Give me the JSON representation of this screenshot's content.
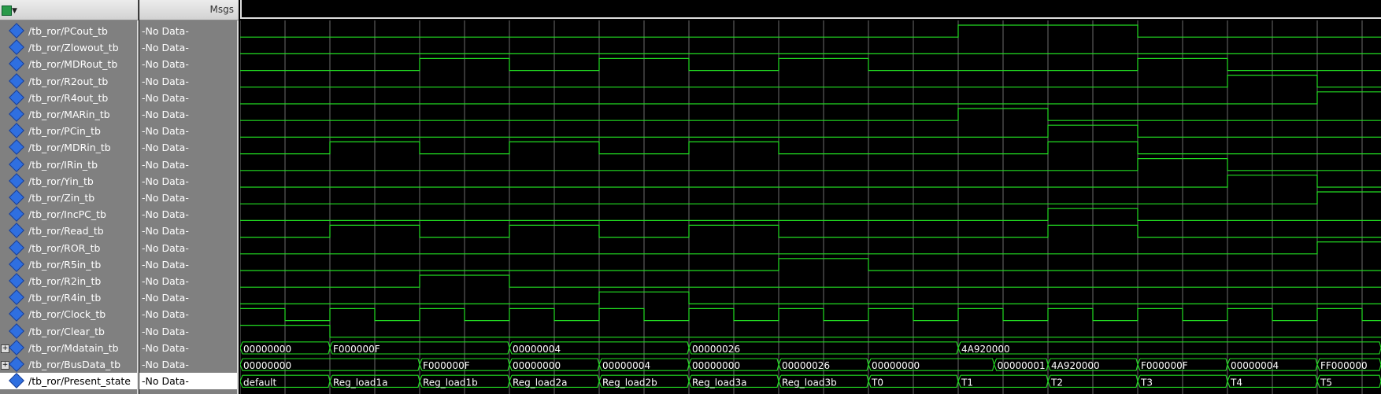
{
  "header": {
    "msgs_label": "Msgs",
    "arrow_icon": "wave-arrow-icon"
  },
  "signals": [
    {
      "name": "/tb_ror/PCout_tb",
      "msg": "-No Data-"
    },
    {
      "name": "/tb_ror/Zlowout_tb",
      "msg": "-No Data-"
    },
    {
      "name": "/tb_ror/MDRout_tb",
      "msg": "-No Data-"
    },
    {
      "name": "/tb_ror/R2out_tb",
      "msg": "-No Data-"
    },
    {
      "name": "/tb_ror/R4out_tb",
      "msg": "-No Data-"
    },
    {
      "name": "/tb_ror/MARin_tb",
      "msg": "-No Data-"
    },
    {
      "name": "/tb_ror/PCin_tb",
      "msg": "-No Data-"
    },
    {
      "name": "/tb_ror/MDRin_tb",
      "msg": "-No Data-"
    },
    {
      "name": "/tb_ror/IRin_tb",
      "msg": "-No Data-"
    },
    {
      "name": "/tb_ror/Yin_tb",
      "msg": "-No Data-"
    },
    {
      "name": "/tb_ror/Zin_tb",
      "msg": "-No Data-"
    },
    {
      "name": "/tb_ror/IncPC_tb",
      "msg": "-No Data-"
    },
    {
      "name": "/tb_ror/Read_tb",
      "msg": "-No Data-"
    },
    {
      "name": "/tb_ror/ROR_tb",
      "msg": "-No Data-"
    },
    {
      "name": "/tb_ror/R5in_tb",
      "msg": "-No Data-"
    },
    {
      "name": "/tb_ror/R2in_tb",
      "msg": "-No Data-"
    },
    {
      "name": "/tb_ror/R4in_tb",
      "msg": "-No Data-"
    },
    {
      "name": "/tb_ror/Clock_tb",
      "msg": "-No Data-"
    },
    {
      "name": "/tb_ror/Clear_tb",
      "msg": "-No Data-"
    },
    {
      "name": "/tb_ror/Mdatain_tb",
      "msg": "-No Data-",
      "expandable": true
    },
    {
      "name": "/tb_ror/BusData_tb",
      "msg": "-No Data-",
      "expandable": true
    },
    {
      "name": "/tb_ror/Present_state",
      "msg": "-No Data-",
      "selected": true
    }
  ],
  "colors": {
    "wave": "#22dd22",
    "grid": "#9a9a9a",
    "panel": "#808080"
  },
  "waves": {
    "PCout_tb": [
      0,
      0,
      0,
      0,
      0,
      0,
      0,
      0,
      1,
      1,
      0,
      0,
      0,
      0.5
    ],
    "Zlowout_tb": [
      0,
      0,
      0,
      0,
      0,
      0,
      0,
      0,
      0,
      0,
      0,
      0,
      0,
      1
    ],
    "MDRout_tb": [
      0,
      0,
      1,
      0,
      1,
      0,
      1,
      0,
      0,
      0,
      1,
      0,
      0,
      0
    ],
    "R2out_tb": [
      0,
      0,
      0,
      0,
      0,
      0,
      0,
      0,
      0,
      0,
      0,
      1,
      0,
      0
    ],
    "R4out_tb": [
      0,
      0,
      0,
      0,
      0,
      0,
      0,
      0,
      0,
      0,
      0,
      0,
      1,
      0
    ],
    "MARin_tb": [
      0,
      0,
      0,
      0,
      0,
      0,
      0,
      0,
      1,
      0,
      0,
      0,
      0,
      0
    ],
    "PCin_tb": [
      0,
      0,
      0,
      0,
      0,
      0,
      0,
      0,
      0,
      1,
      0,
      0,
      0,
      0
    ],
    "MDRin_tb": [
      0,
      1,
      0,
      1,
      0,
      1,
      0,
      0,
      0,
      1,
      0,
      0,
      0,
      0
    ],
    "IRin_tb": [
      0,
      0,
      0,
      0,
      0,
      0,
      0,
      0,
      0,
      0,
      1,
      0,
      0,
      0
    ],
    "Yin_tb": [
      0,
      0,
      0,
      0,
      0,
      0,
      0,
      0,
      0,
      0,
      0,
      1,
      0,
      0
    ],
    "Zin_tb": [
      0,
      0,
      0,
      0,
      0,
      0,
      0,
      0,
      0,
      0,
      0,
      0,
      1,
      0
    ],
    "IncPC_tb": [
      0,
      0,
      0,
      0,
      0,
      0,
      0,
      0,
      0,
      1,
      0,
      0,
      0,
      0
    ],
    "Read_tb": [
      0,
      1,
      0,
      1,
      0,
      1,
      0,
      0,
      0,
      1,
      0,
      0,
      0,
      0
    ],
    "ROR_tb": [
      0,
      0,
      0,
      0,
      0,
      0,
      0,
      0,
      0,
      0,
      0,
      0,
      1,
      0
    ],
    "R5in_tb": [
      0,
      0,
      0,
      0,
      0,
      0,
      1,
      0,
      0,
      0,
      0,
      0,
      0,
      0
    ],
    "R2in_tb": [
      0,
      0,
      1,
      0,
      0,
      0,
      0,
      0,
      0,
      0,
      0,
      0,
      0,
      0
    ],
    "R4in_tb": [
      0,
      0,
      0,
      0,
      1,
      0,
      0,
      0,
      0,
      0,
      0,
      0,
      0,
      0
    ],
    "Clear_tb": [
      1,
      0,
      0,
      0,
      0,
      0,
      0,
      0,
      0,
      0,
      0,
      0,
      0,
      0
    ]
  },
  "buses": {
    "Mdatain_tb": [
      {
        "at": 0,
        "v": "00000000"
      },
      {
        "at": 1,
        "v": "F000000F"
      },
      {
        "at": 3,
        "v": "00000004"
      },
      {
        "at": 5,
        "v": "00000026"
      },
      {
        "at": 8,
        "v": "4A920000"
      }
    ],
    "BusData_tb": [
      {
        "at": 0,
        "v": "00000000"
      },
      {
        "at": 2,
        "v": "F000000F"
      },
      {
        "at": 3,
        "v": "00000000"
      },
      {
        "at": 4,
        "v": "00000004"
      },
      {
        "at": 5,
        "v": "00000000"
      },
      {
        "at": 6,
        "v": "00000026"
      },
      {
        "at": 7,
        "v": "00000000"
      },
      {
        "at": 8.4,
        "v": "00000001"
      },
      {
        "at": 9,
        "v": "4A920000"
      },
      {
        "at": 10,
        "v": "F000000F"
      },
      {
        "at": 11,
        "v": "00000004"
      },
      {
        "at": 12,
        "v": "FF000000"
      }
    ],
    "Present_state": [
      {
        "at": 0,
        "v": "default"
      },
      {
        "at": 1,
        "v": "Reg_load1a"
      },
      {
        "at": 2,
        "v": "Reg_load1b"
      },
      {
        "at": 3,
        "v": "Reg_load2a"
      },
      {
        "at": 4,
        "v": "Reg_load2b"
      },
      {
        "at": 5,
        "v": "Reg_load3a"
      },
      {
        "at": 6,
        "v": "Reg_load3b"
      },
      {
        "at": 7,
        "v": "T0"
      },
      {
        "at": 8,
        "v": "T1"
      },
      {
        "at": 9,
        "v": "T2"
      },
      {
        "at": 10,
        "v": "T3"
      },
      {
        "at": 11,
        "v": "T4"
      },
      {
        "at": 12,
        "v": "T5"
      }
    ]
  }
}
